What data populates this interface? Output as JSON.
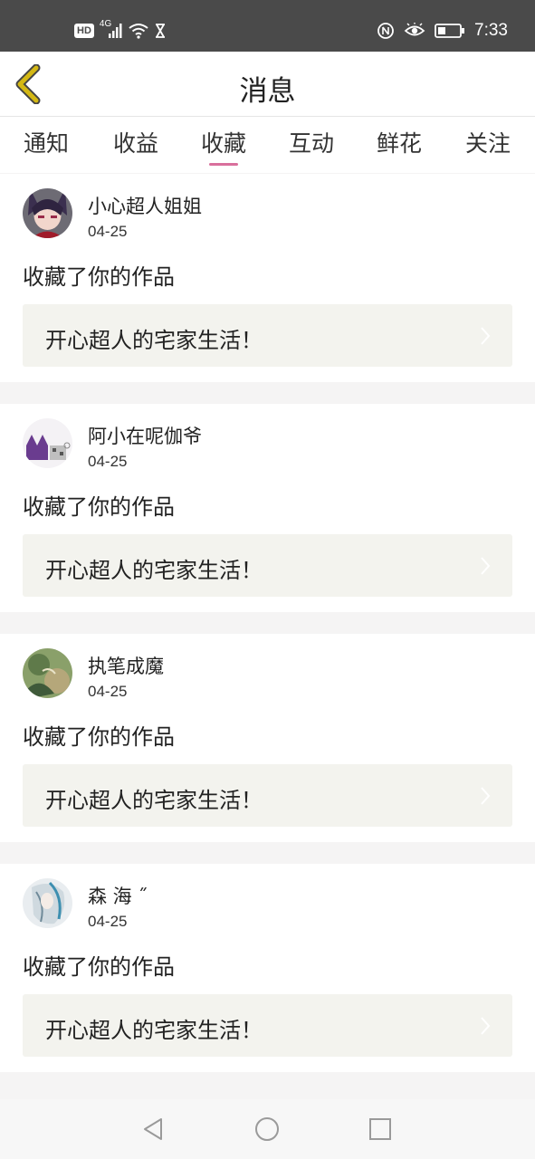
{
  "status_bar": {
    "hd": "HD",
    "network": "4G",
    "time": "7:33",
    "icons": [
      "hd-icon",
      "signal-icon",
      "wifi-icon",
      "hourglass-icon",
      "nfc-icon",
      "eye-icon",
      "battery-icon"
    ]
  },
  "header": {
    "title": "消息",
    "back_icon": "chevron-left-icon",
    "accent_color": "#d4b814"
  },
  "tabs": {
    "items": [
      {
        "label": "通知"
      },
      {
        "label": "收益"
      },
      {
        "label": "收藏"
      },
      {
        "label": "互动"
      },
      {
        "label": "鲜花"
      },
      {
        "label": "关注"
      }
    ],
    "active": "收藏",
    "indicator_color": "#d96f9c"
  },
  "messages": [
    {
      "username": "小心超人姐姐",
      "date": "04-25",
      "action": "收藏了你的作品",
      "work_title": "开心超人的宅家生活！"
    },
    {
      "username": "阿小在呢伽爷",
      "date": "04-25",
      "action": "收藏了你的作品",
      "work_title": "开心超人的宅家生活！"
    },
    {
      "username": "执笔成魔",
      "date": "04-25",
      "action": "收藏了你的作品",
      "work_title": "开心超人的宅家生活！"
    },
    {
      "username": "森 海 ˝",
      "date": "04-25",
      "action": "收藏了你的作品",
      "work_title": "开心超人的宅家生活！"
    }
  ],
  "nav_bar": {
    "icons": [
      "back-triangle-icon",
      "home-circle-icon",
      "recents-square-icon"
    ]
  }
}
